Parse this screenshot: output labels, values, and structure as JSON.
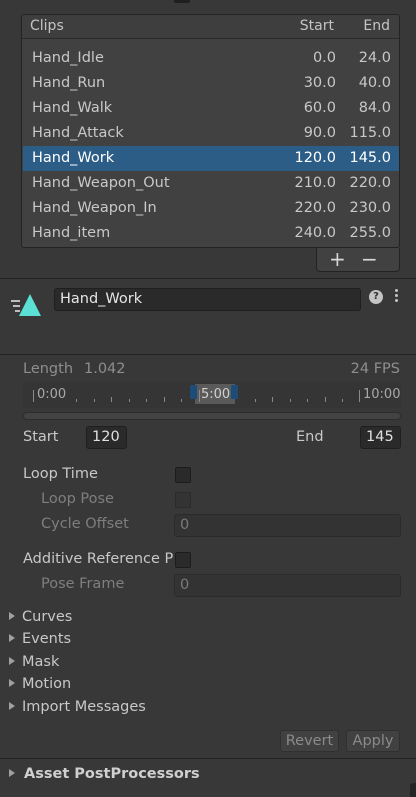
{
  "clips": {
    "header": {
      "name": "Clips",
      "start": "Start",
      "end": "End"
    },
    "items": [
      {
        "name": "Hand_Idle",
        "start": "0.0",
        "end": "24.0",
        "selected": false
      },
      {
        "name": "Hand_Run",
        "start": "30.0",
        "end": "40.0",
        "selected": false
      },
      {
        "name": "Hand_Walk",
        "start": "60.0",
        "end": "84.0",
        "selected": false
      },
      {
        "name": "Hand_Attack",
        "start": "90.0",
        "end": "115.0",
        "selected": false
      },
      {
        "name": "Hand_Work",
        "start": "120.0",
        "end": "145.0",
        "selected": true
      },
      {
        "name": "Hand_Weapon_Out",
        "start": "210.0",
        "end": "220.0",
        "selected": false
      },
      {
        "name": "Hand_Weapon_In",
        "start": "220.0",
        "end": "230.0",
        "selected": false
      },
      {
        "name": "Hand_item",
        "start": "240.0",
        "end": "255.0",
        "selected": false
      }
    ],
    "add_label": "+",
    "remove_label": "−"
  },
  "clip_editor": {
    "name_value": "Hand_Work",
    "help_label": "?",
    "icon": "animation-clip-icon",
    "length_label": "Length",
    "length_value": "1.042",
    "fps_label": "24 FPS",
    "ruler": {
      "start_label": "0:00",
      "mid_label": "5:00",
      "end_label": "10:00"
    },
    "start_label": "Start",
    "start_value": "120",
    "end_label": "End",
    "end_value": "145",
    "loop_time_label": "Loop Time",
    "loop_pose_label": "Loop Pose",
    "cycle_offset_label": "Cycle Offset",
    "cycle_offset_value": "0",
    "additive_label": "Additive Reference P",
    "pose_frame_label": "Pose Frame",
    "pose_frame_value": "0"
  },
  "foldouts": [
    "Curves",
    "Events",
    "Mask",
    "Motion",
    "Import Messages"
  ],
  "buttons": {
    "revert": "Revert",
    "apply": "Apply"
  },
  "asset_postprocessors_label": "Asset PostProcessors",
  "colors": {
    "background": "#383838",
    "selection": "#2c5d87",
    "icon_accent": "#5ce0d6"
  }
}
